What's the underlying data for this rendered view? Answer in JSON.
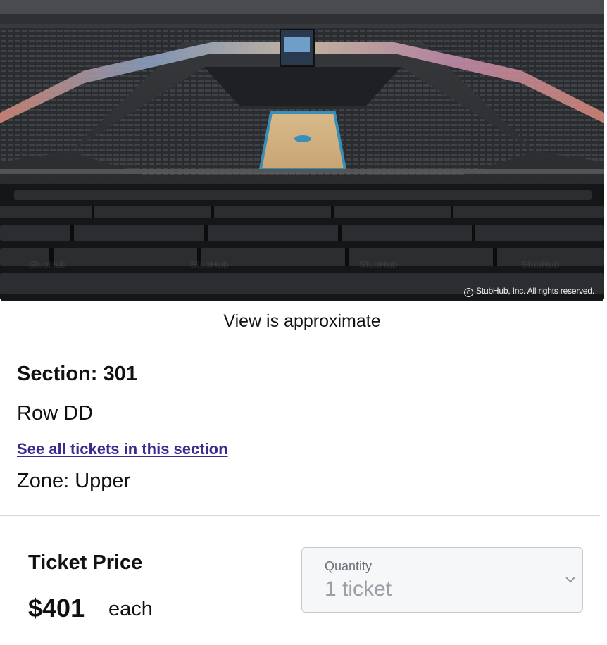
{
  "seat_view": {
    "copyright": "StubHub, Inc. All rights reserved.",
    "watermark": "StubHub",
    "caption": "View is approximate"
  },
  "seat_info": {
    "section": "Section: 301",
    "row": "Row DD",
    "see_all_link": "See all tickets in this section",
    "zone": "Zone: Upper"
  },
  "pricing": {
    "label": "Ticket Price",
    "amount": "$401",
    "unit": "each"
  },
  "quantity": {
    "label": "Quantity",
    "selected": "1 ticket"
  },
  "icons": {
    "copyright_mark": "copyright-icon",
    "dropdown": "chevron-down-icon"
  },
  "colors": {
    "link": "#3b2a8f",
    "divider": "#d5d7dc",
    "select_background": "#f6f7f8"
  }
}
